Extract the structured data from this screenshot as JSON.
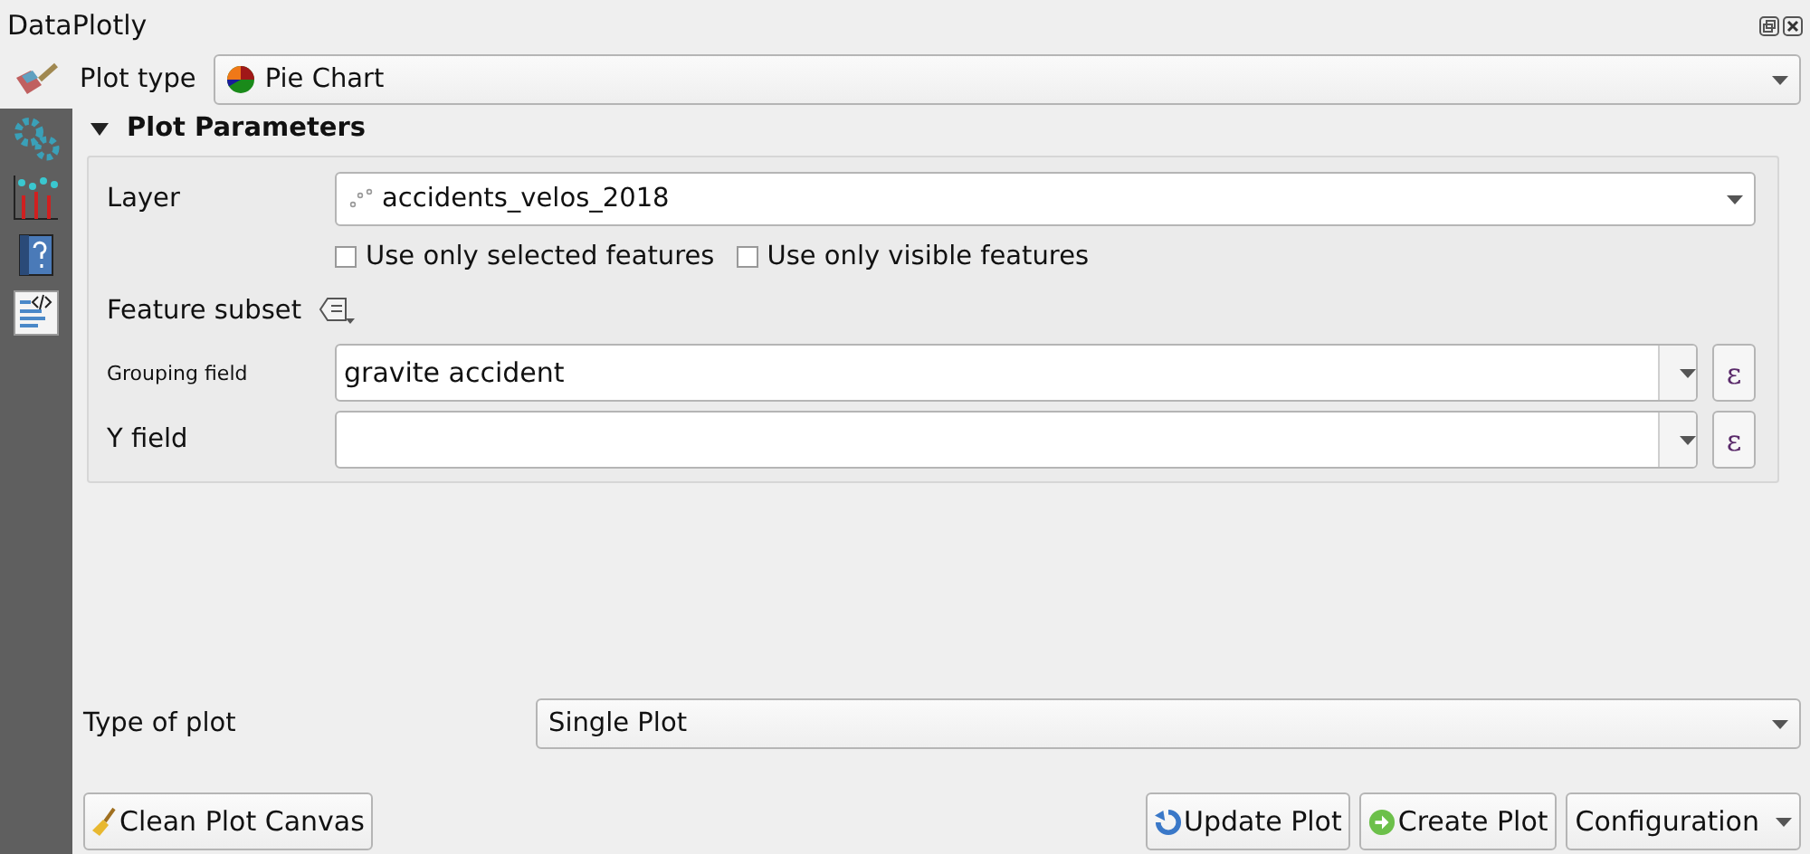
{
  "window": {
    "title": "DataPlotly"
  },
  "plot_type": {
    "label": "Plot type",
    "value": "Pie Chart"
  },
  "section": {
    "title": "Plot Parameters",
    "expanded": true
  },
  "layer": {
    "label": "Layer",
    "value": "accidents_velos_2018"
  },
  "checkboxes": [
    {
      "label": "Use only selected features",
      "checked": false
    },
    {
      "label": "Use only visible features",
      "checked": false
    }
  ],
  "feature_subset": {
    "label": "Feature subset"
  },
  "fields": [
    {
      "label": "Grouping field",
      "small": true,
      "value": "gravite accident",
      "expr": "ε"
    },
    {
      "label": "Y field",
      "small": false,
      "expr": "ε"
    }
  ],
  "type_of_plot": {
    "label": "Type of plot",
    "value": "Single Plot"
  },
  "buttons": [
    {
      "kind": "clean",
      "label": "Clean Plot Canvas"
    },
    {
      "kind": "update",
      "label": "Update Plot"
    },
    {
      "kind": "create",
      "label": "Create Plot"
    },
    {
      "kind": "menu",
      "label": "Configuration"
    }
  ]
}
